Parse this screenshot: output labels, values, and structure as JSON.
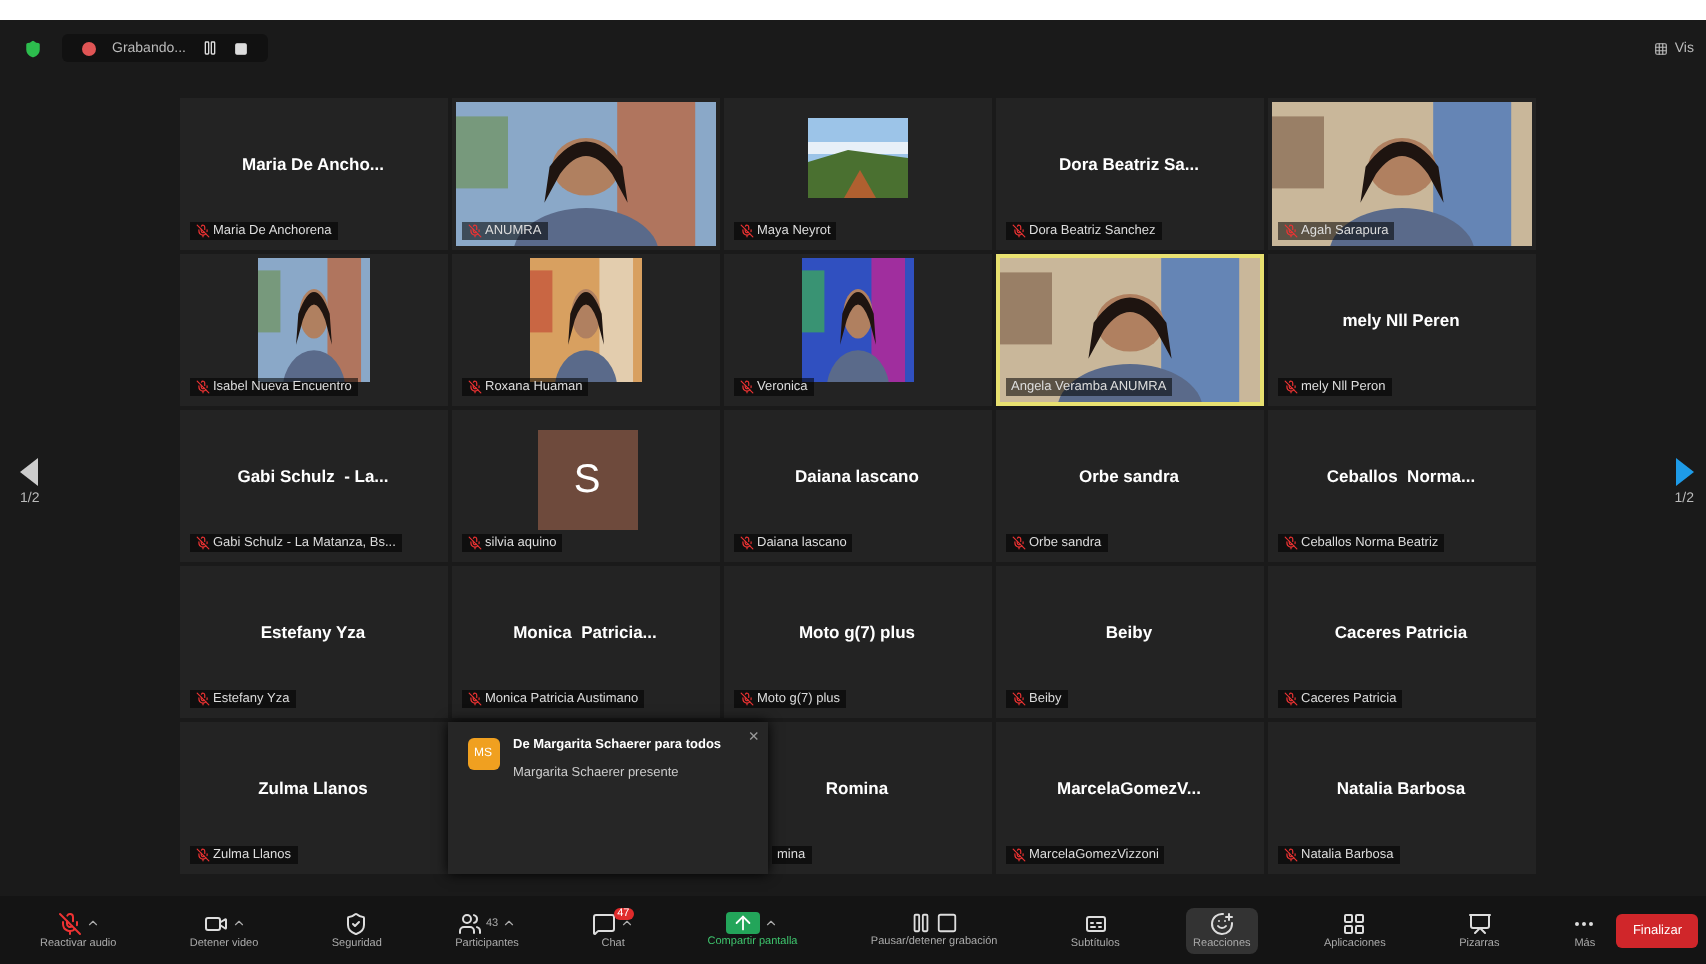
{
  "top_bar": {
    "recording": {
      "label": "Grabando...",
      "paused": false
    },
    "view_label": "Vis"
  },
  "pager": {
    "left": "1/2",
    "right": "1/2"
  },
  "tiles": [
    {
      "kind": "name",
      "title": "Maria De Ancho...",
      "label": "Maria De Anchorena",
      "muted": true,
      "speaking": false
    },
    {
      "kind": "video",
      "label": "ANUMRA",
      "muted": true,
      "speaking": false
    },
    {
      "kind": "scenery",
      "label": "Maya Neyrot",
      "muted": true,
      "speaking": false
    },
    {
      "kind": "name",
      "title": "Dora Beatriz Sa...",
      "label": "Dora Beatriz Sanchez",
      "muted": true,
      "speaking": false
    },
    {
      "kind": "video",
      "label": "Agah Sarapura",
      "muted": true,
      "speaking": false
    },
    {
      "kind": "portrait",
      "label": "Isabel Nueva Encuentro",
      "muted": true,
      "speaking": false
    },
    {
      "kind": "portrait",
      "label": "Roxana Huaman",
      "muted": true,
      "speaking": false
    },
    {
      "kind": "portrait",
      "label": "Veronica",
      "muted": true,
      "speaking": false
    },
    {
      "kind": "video",
      "label": "Angela Veramba ANUMRA",
      "muted": false,
      "speaking": true
    },
    {
      "kind": "name",
      "title": "mely Nll Peren",
      "label": "mely Nll Peron",
      "muted": true,
      "speaking": false
    },
    {
      "kind": "name",
      "title": "Gabi Schulz  - La...",
      "label": "Gabi Schulz - La Matanza, Bs...",
      "muted": true,
      "speaking": false
    },
    {
      "kind": "avatar",
      "initial": "S",
      "label": "silvia aquino",
      "muted": true,
      "speaking": false
    },
    {
      "kind": "name",
      "title": "Daiana lascano",
      "label": "Daiana lascano",
      "muted": true,
      "speaking": false
    },
    {
      "kind": "name",
      "title": "Orbe sandra",
      "label": "Orbe sandra",
      "muted": true,
      "speaking": false
    },
    {
      "kind": "name",
      "title": "Ceballos  Norma...",
      "label": "Ceballos Norma Beatriz",
      "muted": true,
      "speaking": false
    },
    {
      "kind": "name",
      "title": "Estefany Yza",
      "label": "Estefany Yza",
      "muted": true,
      "speaking": false
    },
    {
      "kind": "name",
      "title": "Monica  Patricia...",
      "label": "Monica Patricia Austimano",
      "muted": true,
      "speaking": false
    },
    {
      "kind": "name",
      "title": "Moto g(7) plus",
      "label": "Moto g(7) plus",
      "muted": true,
      "speaking": false
    },
    {
      "kind": "name",
      "title": "Beiby",
      "label": "Beiby",
      "muted": true,
      "speaking": false
    },
    {
      "kind": "name",
      "title": "Caceres Patricia",
      "label": "Caceres Patricia",
      "muted": true,
      "speaking": false
    },
    {
      "kind": "name",
      "title": "Zulma Llanos",
      "label": "Zulma Llanos",
      "muted": true,
      "speaking": false
    },
    {
      "kind": "blank"
    },
    {
      "kind": "name",
      "title": "Romina",
      "label": "mina",
      "muted": false,
      "speaking": false,
      "covered": true
    },
    {
      "kind": "name",
      "title": "MarcelaGomezV...",
      "label": "MarcelaGomezVizzoni",
      "muted": true,
      "speaking": false
    },
    {
      "kind": "name",
      "title": "Natalia Barbosa",
      "label": "Natalia Barbosa",
      "muted": true,
      "speaking": false
    }
  ],
  "chat_popup": {
    "avatar": "MS",
    "title": "De Margarita Schaerer para todos",
    "message": "Margarita Schaerer presente",
    "close": "×"
  },
  "toolbar": [
    {
      "kind": "mic",
      "label": "Reactivar audio",
      "selected": false
    },
    {
      "kind": "video",
      "label": "Detener video",
      "selected": false
    },
    {
      "kind": "security",
      "label": "Seguridad",
      "selected": false
    },
    {
      "kind": "participants",
      "label": "Participantes",
      "count": "43",
      "selected": false
    },
    {
      "kind": "chat",
      "label": "Chat",
      "badge": "47",
      "selected": false
    },
    {
      "kind": "share",
      "label": "Compartir pantalla",
      "selected": false
    },
    {
      "kind": "record",
      "label": "Pausar/detener grabación",
      "selected": false
    },
    {
      "kind": "captions",
      "label": "Subtítulos",
      "selected": false
    },
    {
      "kind": "reactions",
      "label": "Reacciones",
      "selected": true
    },
    {
      "kind": "apps",
      "label": "Aplicaciones",
      "selected": false
    },
    {
      "kind": "whiteboard",
      "label": "Pizarras",
      "selected": false
    },
    {
      "kind": "more",
      "label": "Más",
      "selected": false
    }
  ],
  "end_button": "Finalizar"
}
